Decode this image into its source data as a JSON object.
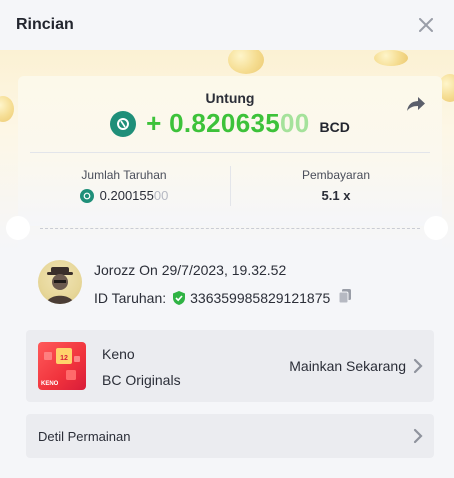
{
  "header": {
    "title": "Rincian"
  },
  "result": {
    "label": "Untung",
    "amount_prefix": "+ 0.820635",
    "amount_faded": "00",
    "currency": "BCD"
  },
  "stats": {
    "bet_amount_label": "Jumlah Taruhan",
    "bet_amount_value": "0.200155",
    "bet_amount_faded": "00",
    "payout_label": "Pembayaran",
    "payout_value": "5.1 x"
  },
  "bet": {
    "user_line": "Jorozz On 29/7/2023, 19.32.52",
    "bet_id_label": "ID Taruhan:",
    "bet_id": "336359985829121875"
  },
  "game": {
    "thumb_badge": "12",
    "thumb_label": "KENO",
    "name": "Keno",
    "provider": "BC Originals",
    "play_label": "Mainkan Sekarang"
  },
  "details": {
    "label": "Detil Permainan"
  },
  "colors": {
    "profit_green": "#3dc23a",
    "bc_icon": "#1f8f79",
    "shield_green": "#2fb344",
    "keno_red": "#f0323c"
  },
  "icons": [
    "close-icon",
    "share-icon",
    "bc-coin-icon",
    "shield-check-icon",
    "copy-icon",
    "chevron-right-icon"
  ]
}
